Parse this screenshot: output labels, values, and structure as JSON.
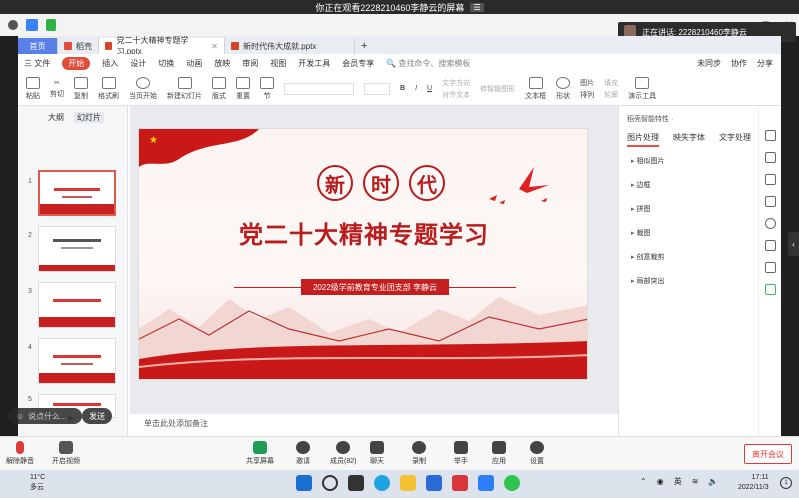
{
  "share_banner": {
    "text": "你正在观看2228210460李静云的屏幕",
    "menu_icon": "hamburger-icon"
  },
  "presenter": {
    "text": "正在讲话: 2228210460李静云"
  },
  "wps": {
    "tabs": [
      {
        "label": "首页"
      },
      {
        "label": "稻壳"
      },
      {
        "label": "党二十大精神专题学习.pptx"
      },
      {
        "label": "新时代伟大成就.pptx"
      }
    ],
    "menu": {
      "file": "三 文件",
      "start": "开始",
      "items": [
        "插入",
        "设计",
        "切换",
        "动画",
        "放映",
        "审阅",
        "视图",
        "开发工具",
        "会员专享"
      ],
      "search": "查找命令、搜索模板",
      "right": [
        "未同步",
        "协作",
        "分享"
      ]
    },
    "ribbon": {
      "buttons": [
        "粘贴",
        "剪切",
        "复制",
        "格式刷",
        "当页开始",
        "新建幻灯片",
        "版式",
        "重置",
        "节"
      ],
      "grey": [
        "文字方向",
        "对齐文本",
        "转智能图形",
        "文本框",
        "形状",
        "排列",
        "轮廓",
        "演示工具"
      ],
      "picture": "图片",
      "fill": "填充"
    },
    "thumbs": {
      "tabs": [
        "大纲",
        "幻灯片"
      ],
      "numbers": [
        "1",
        "2",
        "3",
        "4",
        "5"
      ]
    },
    "chat_placeholder": "说点什么...",
    "chat_send": "发送",
    "note_placeholder": "单击此处添加备注",
    "slide": {
      "chars": [
        "新",
        "时",
        "代"
      ],
      "title": "党二十大精神专题学习",
      "badge": "2022级学前教育专业团支部  李静云"
    },
    "right_panel": {
      "header": "稻壳智能特性 ·",
      "tabs": [
        "图片处理",
        "映失字体",
        "文字处理"
      ],
      "items": [
        "相似图片",
        "边框",
        "拼图",
        "裁图",
        "创意裁剪",
        "局部突出"
      ]
    }
  },
  "meeting_toolbar": {
    "buttons": [
      "解除静音",
      "开启视频",
      "共享屏幕",
      "邀请",
      "成员(82)",
      "聊天",
      "录制",
      "举手",
      "应用",
      "设置"
    ],
    "leave": "离开会议"
  },
  "taskbar": {
    "weather_temp": "11°C",
    "weather_desc": "多云",
    "lang": "英",
    "time": "17:11",
    "date": "2022/11/3",
    "notif": "1"
  },
  "colors": {
    "accent_red": "#c41e1e",
    "wps_blue": "#5b7fe8",
    "leave_red": "#e03b3b"
  }
}
